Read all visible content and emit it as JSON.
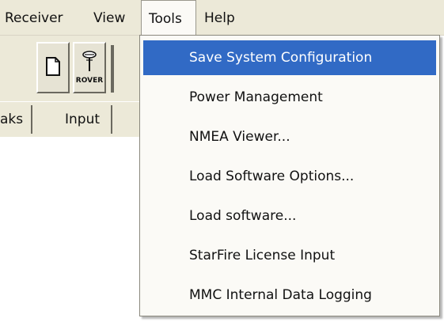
{
  "menubar": {
    "receiver": "Receiver",
    "view": "View",
    "tools": "Tools",
    "help": "Help"
  },
  "toolbar": {
    "new_icon": "new-document-icon",
    "rover_icon": "rover-antenna-icon",
    "rover_label": "ROVER"
  },
  "tabs": {
    "peaks_fragment": "aks",
    "input": "Input"
  },
  "tools_menu": {
    "items": [
      {
        "label": "Save System Configuration",
        "selected": true
      },
      {
        "label": "Power Management"
      },
      {
        "label": "NMEA Viewer..."
      },
      {
        "label": "Load Software Options..."
      },
      {
        "label": "Load software..."
      },
      {
        "label": "StarFire License Input"
      },
      {
        "label": "MMC Internal Data Logging"
      }
    ]
  },
  "colors": {
    "highlight": "#316ac5",
    "menu_bg": "#fbfaf6",
    "chrome": "#ece9d8"
  }
}
